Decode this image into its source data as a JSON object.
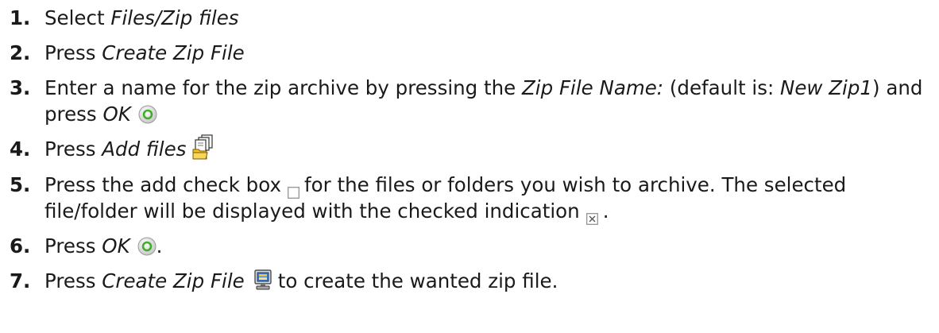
{
  "steps": [
    {
      "num": "1.",
      "t1": "Select ",
      "em1": "Files/Zip files"
    },
    {
      "num": "2.",
      "t1": "Press ",
      "em1": "Create Zip File"
    },
    {
      "num": "3.",
      "t1": "Enter a name for the zip archive by pressing the ",
      "em1": "Zip File Name:",
      "t2": " (default is: ",
      "em2": "New Zip1",
      "t3": ") and press ",
      "em3": "OK",
      "icon": "ok-circle-icon"
    },
    {
      "num": "4.",
      "t1": "Press ",
      "em1": "Add files",
      "icon": "add-files-icon"
    },
    {
      "num": "5.",
      "t1": "Press the add check box",
      "t2": "for the files or folders you wish to archive. The selected file/folder will be displayed with the checked indication",
      "t3": ".",
      "icons": [
        "unchecked-box-icon",
        "checked-box-icon"
      ]
    },
    {
      "num": "6.",
      "t1": "Press ",
      "em1": "OK",
      "t2": ".",
      "icon": "ok-circle-icon"
    },
    {
      "num": "7.",
      "t1": "Press ",
      "em1": "Create Zip File",
      "t2": "to create the wanted zip file.",
      "icon": "create-zip-file-icon"
    }
  ],
  "colors": {
    "ok_ring": "#3fae2a",
    "checkbox_border": "#8c8c8c",
    "zip_screen": "#3b78c8",
    "folder_yellow": "#f3c22b"
  }
}
